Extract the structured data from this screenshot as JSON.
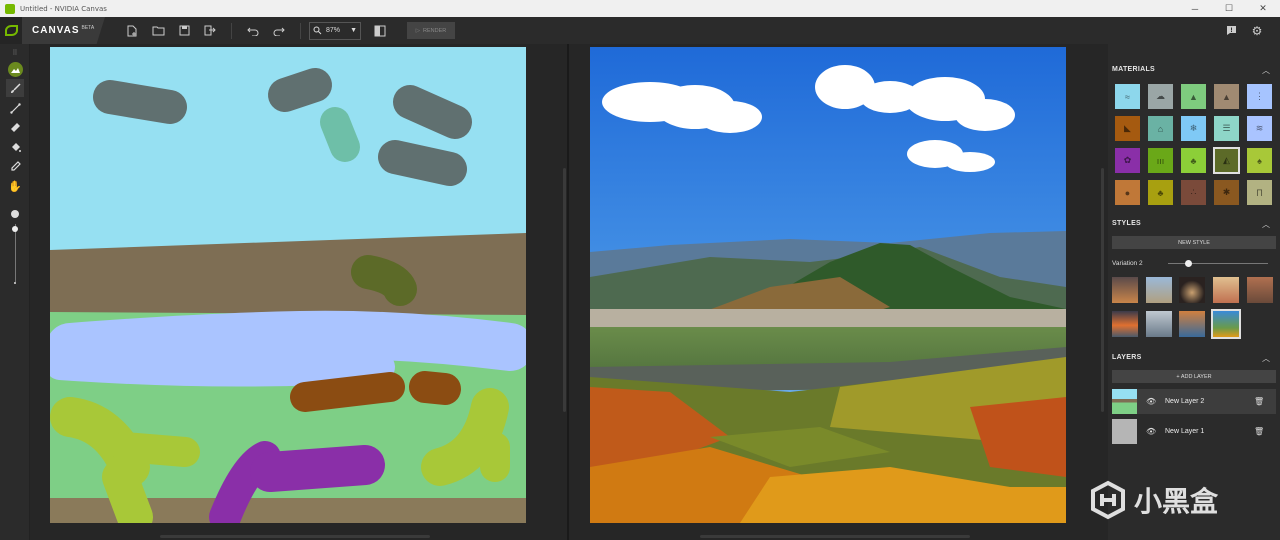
{
  "window": {
    "title": "Untitled - NVIDIA Canvas",
    "min": "─",
    "max": "☐",
    "close": "✕"
  },
  "brand": {
    "name": "CANVAS",
    "beta": "BETA",
    "logo_icon": "nvidia-eye-icon",
    "logo_text": "NVIDIA"
  },
  "toolbar": {
    "zoom_value": "87%",
    "render_label": "RENDER",
    "icons": [
      "new-file-icon",
      "open-folder-icon",
      "save-icon",
      "export-icon",
      "undo-icon",
      "redo-icon",
      "zoom-icon",
      "compare-view-icon",
      "feedback-icon",
      "settings-icon"
    ]
  },
  "tools": [
    "material-brush-icon",
    "brush-icon",
    "line-icon",
    "eraser-icon",
    "fill-bucket-icon",
    "eyedropper-icon",
    "pan-hand-icon"
  ],
  "panel": {
    "materials": {
      "title": "MATERIALS",
      "swatches": [
        {
          "name": "sky",
          "color": "#8dd7ec"
        },
        {
          "name": "cloud",
          "color": "#9aa6a6"
        },
        {
          "name": "mountain",
          "color": "#7ecb7e"
        },
        {
          "name": "snowy-peak",
          "color": "#a08a72"
        },
        {
          "name": "fog",
          "color": "#a6c4ff"
        },
        {
          "name": "rock",
          "color": "#a55a10"
        },
        {
          "name": "house",
          "color": "#6ab2a4"
        },
        {
          "name": "snow",
          "color": "#7fc9f6"
        },
        {
          "name": "water-lines",
          "color": "#8ed6c8"
        },
        {
          "name": "river",
          "color": "#aac4ff"
        },
        {
          "name": "flower",
          "color": "#8a2fa8"
        },
        {
          "name": "grass",
          "color": "#6aa818"
        },
        {
          "name": "bush",
          "color": "#8ccf38"
        },
        {
          "name": "hill",
          "color": "#5c6a28"
        },
        {
          "name": "tree",
          "color": "#a8c838"
        },
        {
          "name": "stone",
          "color": "#c07838"
        },
        {
          "name": "palm",
          "color": "#a8a010"
        },
        {
          "name": "gravel",
          "color": "#7a4a3a"
        },
        {
          "name": "dirt",
          "color": "#8a5820"
        },
        {
          "name": "pillar",
          "color": "#b2b282"
        }
      ],
      "selected_index": 13
    },
    "styles": {
      "title": "STYLES",
      "new_style_label": "NEW STYLE",
      "variation_label": "Variation 2",
      "slider_value": 0.2
    },
    "layers": {
      "title": "LAYERS",
      "add_label": "+ ADD LAYER",
      "items": [
        {
          "name": "New Layer 2",
          "active": true
        },
        {
          "name": "New Layer 1",
          "active": false
        }
      ]
    }
  },
  "watermark": {
    "text": "小黑盒"
  }
}
